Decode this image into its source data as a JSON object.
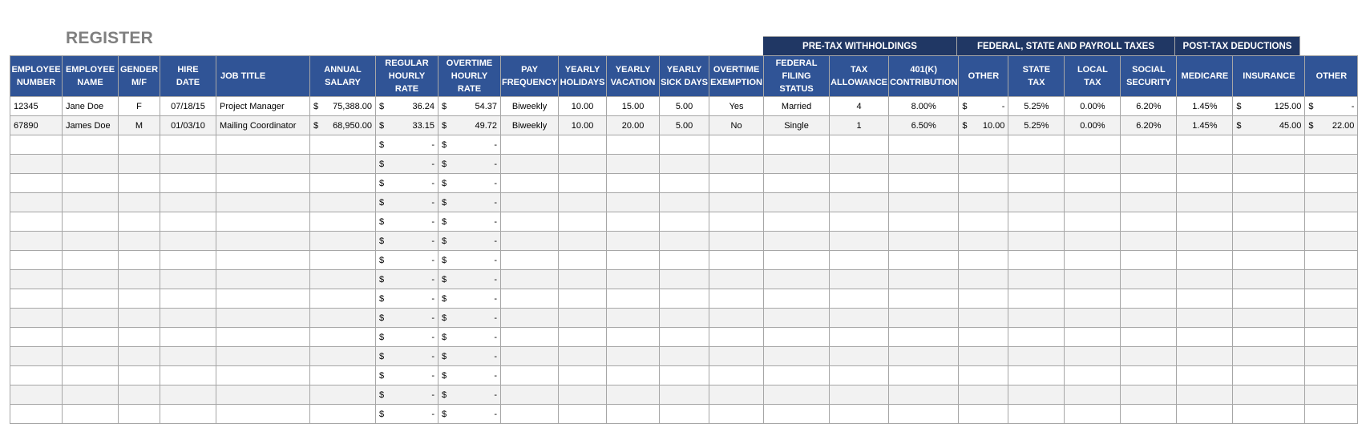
{
  "title": "REGISTER",
  "group_headers": [
    {
      "label": "PRE-TAX WITHHOLDINGS",
      "span": 4
    },
    {
      "label": "FEDERAL, STATE AND PAYROLL TAXES",
      "span": 4
    },
    {
      "label": "POST-TAX DEDUCTIONS",
      "span": 2
    }
  ],
  "columns": [
    {
      "key": "emp_number",
      "label": "EMPLOYEE\nNUMBER"
    },
    {
      "key": "emp_name",
      "label": "EMPLOYEE\nNAME"
    },
    {
      "key": "gender",
      "label": "GENDER\nM/F"
    },
    {
      "key": "hire_date",
      "label": "HIRE\nDATE"
    },
    {
      "key": "job_title",
      "label": "JOB TITLE"
    },
    {
      "key": "annual_salary",
      "label": "ANNUAL\nSALARY"
    },
    {
      "key": "regular_rate",
      "label": "REGULAR\nHOURLY RATE"
    },
    {
      "key": "overtime_rate",
      "label": "OVERTIME\nHOURLY RATE"
    },
    {
      "key": "pay_frequency",
      "label": "PAY\nFREQUENCY"
    },
    {
      "key": "yearly_holidays",
      "label": "YEARLY\nHOLIDAYS"
    },
    {
      "key": "yearly_vacation",
      "label": "YEARLY\nVACATION"
    },
    {
      "key": "yearly_sick_days",
      "label": "YEARLY\nSICK DAYS"
    },
    {
      "key": "overtime_exemption",
      "label": "OVERTIME\nEXEMPTION"
    },
    {
      "key": "federal_filing_status",
      "label": "FEDERAL\nFILING STATUS"
    },
    {
      "key": "tax_allowance",
      "label": "TAX\nALLOWANCE"
    },
    {
      "key": "contribution_401k",
      "label": "401(K)\nCONTRIBUTION"
    },
    {
      "key": "pretax_other",
      "label": "OTHER"
    },
    {
      "key": "state_tax",
      "label": "STATE\nTAX"
    },
    {
      "key": "local_tax",
      "label": "LOCAL\nTAX"
    },
    {
      "key": "social_security",
      "label": "SOCIAL\nSECURITY"
    },
    {
      "key": "medicare",
      "label": "MEDICARE"
    },
    {
      "key": "insurance",
      "label": "INSURANCE"
    },
    {
      "key": "posttax_other",
      "label": "OTHER"
    }
  ],
  "currency_symbol": "$",
  "empty_money": "-",
  "rows": [
    {
      "emp_number": "12345",
      "emp_name": "Jane Doe",
      "gender": "F",
      "hire_date": "07/18/15",
      "job_title": "Project Manager",
      "annual_salary": "75,388.00",
      "regular_rate": "36.24",
      "overtime_rate": "54.37",
      "pay_frequency": "Biweekly",
      "yearly_holidays": "10.00",
      "yearly_vacation": "15.00",
      "yearly_sick_days": "5.00",
      "overtime_exemption": "Yes",
      "federal_filing_status": "Married",
      "tax_allowance": "4",
      "contribution_401k": "8.00%",
      "pretax_other": "-",
      "state_tax": "5.25%",
      "local_tax": "0.00%",
      "social_security": "6.20%",
      "medicare": "1.45%",
      "insurance": "125.00",
      "posttax_other": "-"
    },
    {
      "emp_number": "67890",
      "emp_name": "James Doe",
      "gender": "M",
      "hire_date": "01/03/10",
      "job_title": "Mailing Coordinator",
      "annual_salary": "68,950.00",
      "regular_rate": "33.15",
      "overtime_rate": "49.72",
      "pay_frequency": "Biweekly",
      "yearly_holidays": "10.00",
      "yearly_vacation": "20.00",
      "yearly_sick_days": "5.00",
      "overtime_exemption": "No",
      "federal_filing_status": "Single",
      "tax_allowance": "1",
      "contribution_401k": "6.50%",
      "pretax_other": "10.00",
      "state_tax": "5.25%",
      "local_tax": "0.00%",
      "social_security": "6.20%",
      "medicare": "1.45%",
      "insurance": "45.00",
      "posttax_other": "22.00"
    }
  ],
  "empty_row_count": 15
}
